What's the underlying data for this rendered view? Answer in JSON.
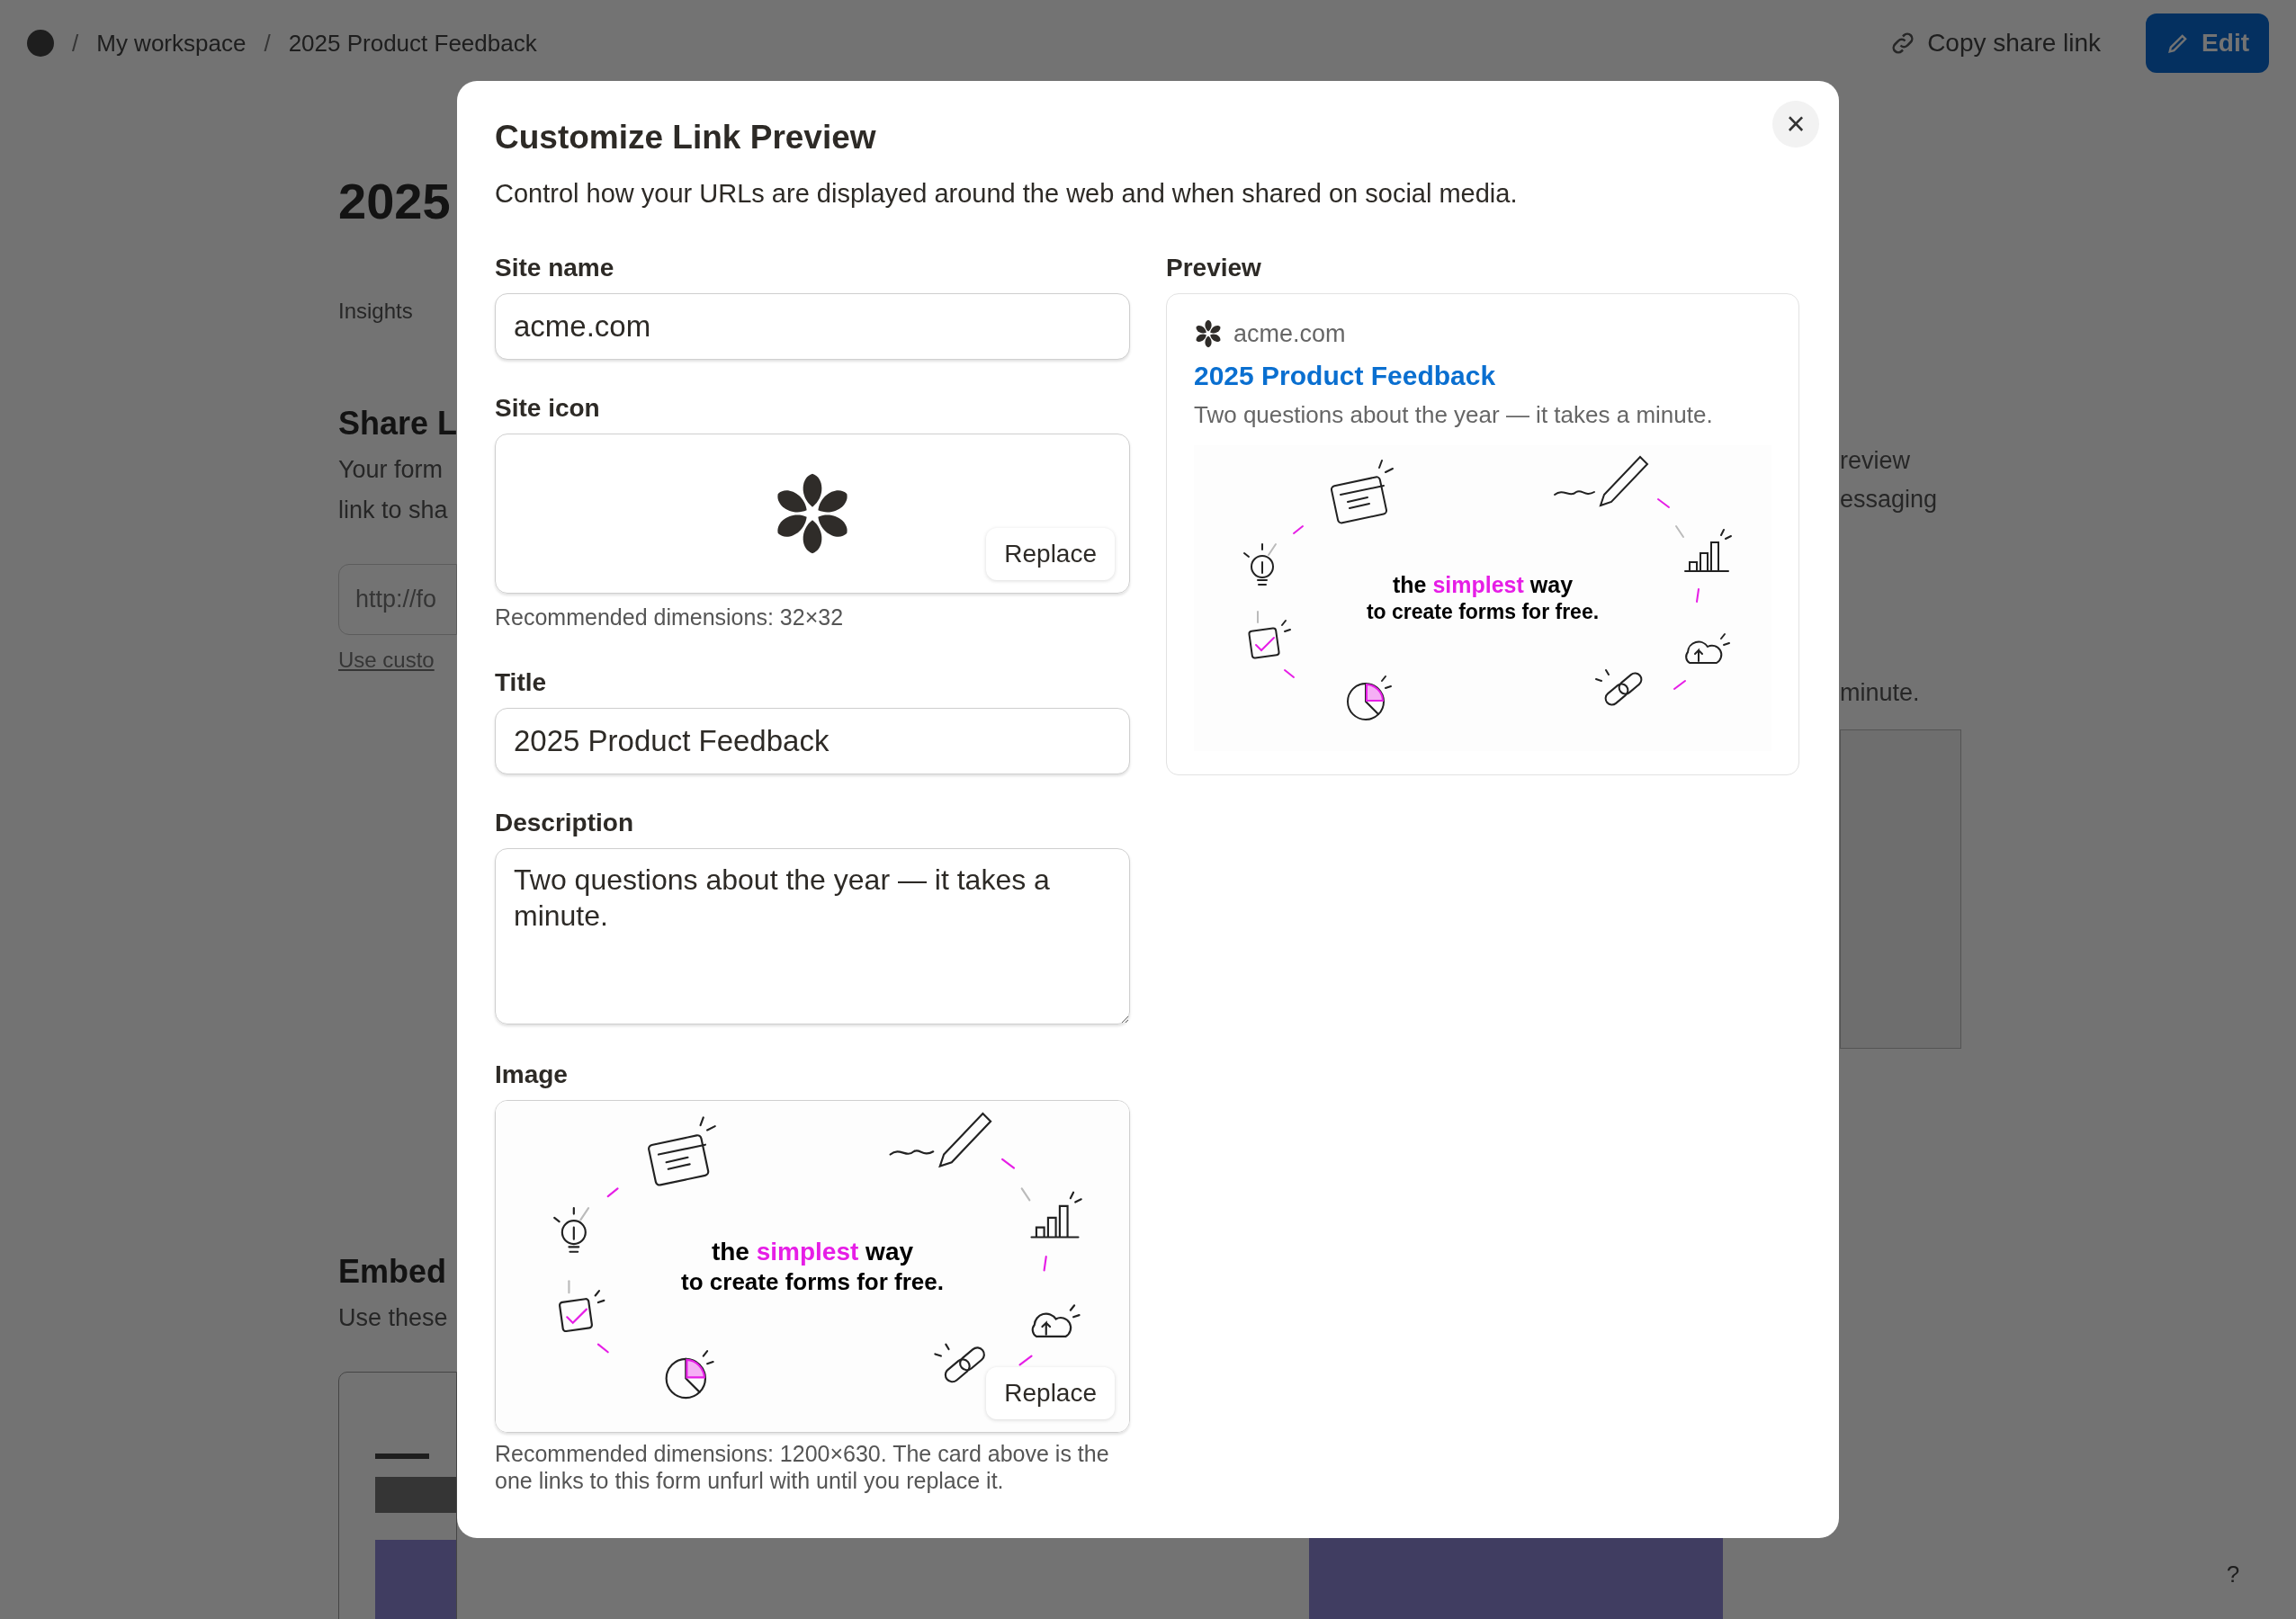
{
  "topbar": {
    "breadcrumb": [
      {
        "label": "My workspace"
      },
      {
        "label": "2025 Product Feedback"
      }
    ],
    "separator": "/",
    "copy_link": "Copy share link",
    "edit_button": "Edit"
  },
  "background_page": {
    "left_sections": [
      {
        "items": [
          {
            "kind": "heading",
            "text": "2025"
          },
          {
            "kind": "label",
            "text": "Insights"
          },
          {
            "kind": "subheading",
            "text": "Share L"
          },
          {
            "kind": "para",
            "text": "Your form"
          },
          {
            "kind": "para",
            "text": "link to sha"
          },
          {
            "kind": "field",
            "text": "http://fo"
          },
          {
            "kind": "link",
            "text": "Use custo"
          }
        ]
      },
      {
        "items": [
          {
            "kind": "subheading",
            "text": "Embed"
          },
          {
            "kind": "para",
            "text": "Use these"
          }
        ]
      }
    ],
    "right_fragments": [
      {
        "text": "review"
      },
      {
        "text": "essaging"
      },
      {
        "text": "minute."
      }
    ],
    "help_button": "?"
  },
  "dialog": {
    "title": "Customize Link Preview",
    "description": "Control how your URLs are displayed around the web and when shared on social media.",
    "close": "×",
    "site_name": {
      "label": "Site name",
      "value": "acme.com"
    },
    "site_icon": {
      "label": "Site icon",
      "button": "Replace",
      "hint": "Recommended dimensions: 32×32"
    },
    "title_field": {
      "label": "Title",
      "value": "2025 Product Feedback"
    },
    "description_field": {
      "label": "Description",
      "value": "Two questions about the year — it takes a minute."
    },
    "image": {
      "label": "Image",
      "button": "Replace",
      "hint": "Recommended dimensions: 1200×630. The card above is the one links to this form unfurl with until you replace it."
    },
    "banner": {
      "before": "the",
      "highlight": "simplest",
      "after": "way",
      "line2": "to create forms for free."
    },
    "preview": {
      "label": "Preview",
      "site": "acme.com",
      "title": "2025 Product Feedback",
      "description": "Two questions about the year — it takes a minute.",
      "banner": {
        "before": "the",
        "highlight": "simplest",
        "after": "way",
        "line2": "to create forms for free."
      }
    }
  }
}
